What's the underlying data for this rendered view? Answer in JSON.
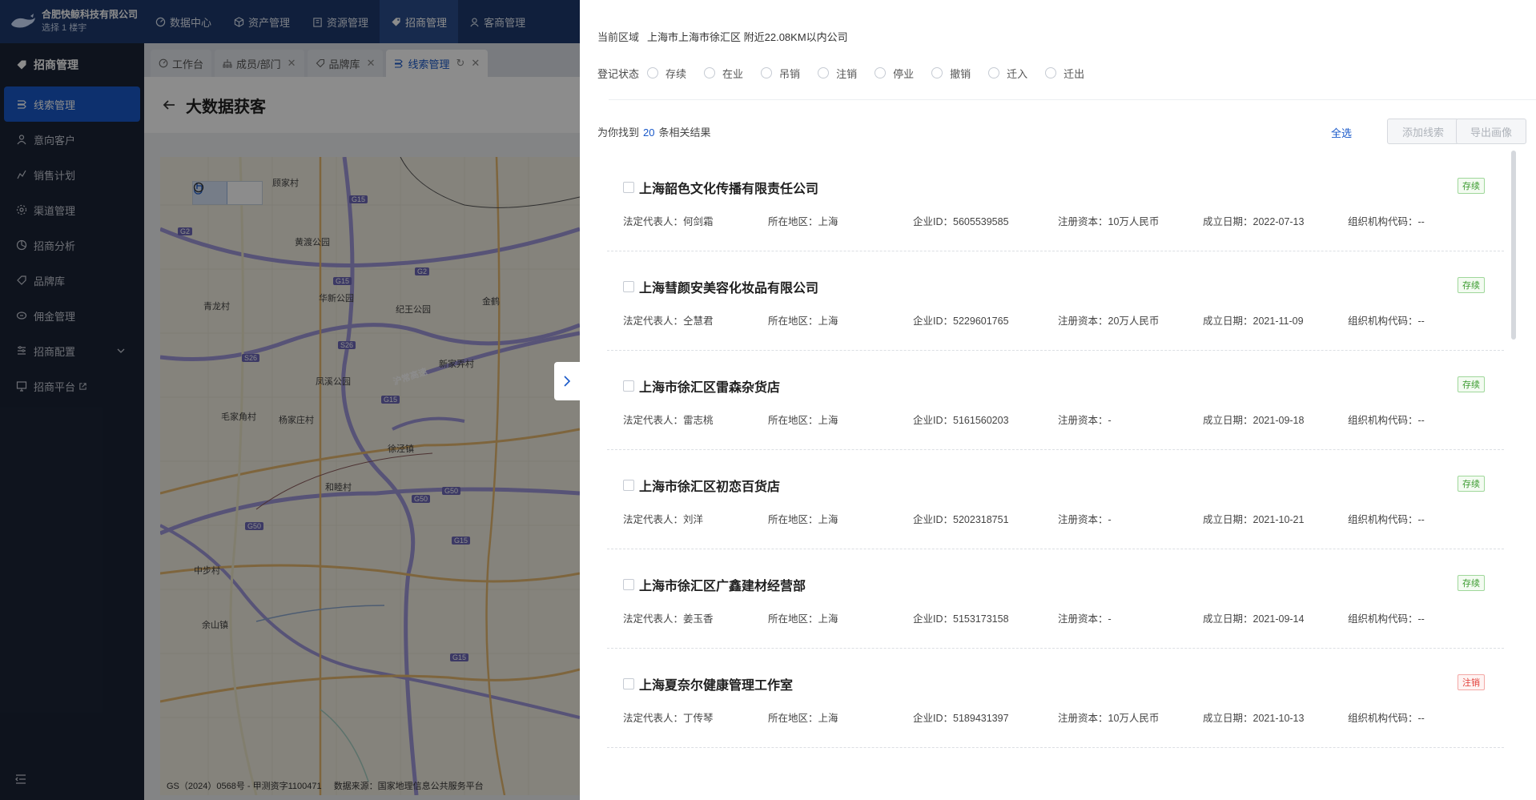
{
  "brand": {
    "name": "合肥快鲸科技有限公司",
    "floor": "选择 1 楼宇"
  },
  "topnav": [
    {
      "label": "数据中心",
      "icon": "dashboard-icon",
      "active": false
    },
    {
      "label": "资产管理",
      "icon": "cube-icon",
      "active": false
    },
    {
      "label": "资源管理",
      "icon": "building-icon",
      "active": false
    },
    {
      "label": "招商管理",
      "icon": "tag-icon",
      "active": true
    },
    {
      "label": "客商管理",
      "icon": "user-group-icon",
      "active": false
    }
  ],
  "sidebar": {
    "title": "招商管理",
    "items": [
      {
        "label": "线索管理",
        "icon": "clue-icon",
        "active": true
      },
      {
        "label": "意向客户",
        "icon": "user-icon"
      },
      {
        "label": "销售计划",
        "icon": "plan-icon"
      },
      {
        "label": "渠道管理",
        "icon": "channel-icon"
      },
      {
        "label": "招商分析",
        "icon": "analysis-icon"
      },
      {
        "label": "品牌库",
        "icon": "brand-icon"
      },
      {
        "label": "佣金管理",
        "icon": "commission-icon"
      },
      {
        "label": "招商配置",
        "icon": "config-icon"
      },
      {
        "label": "招商平台",
        "icon": "platform-icon"
      }
    ]
  },
  "tabs": [
    {
      "label": "工作台",
      "icon": "dashboard-icon"
    },
    {
      "label": "成员/部门",
      "icon": "org-icon"
    },
    {
      "label": "品牌库",
      "icon": "brand-icon"
    },
    {
      "label": "线索管理",
      "icon": "clue-icon"
    }
  ],
  "page": {
    "title": "大数据获客"
  },
  "map": {
    "attribution": "GS（2024）0568号 - 甲测资字1100471",
    "attribution2": "数据来源：国家地理信息公共服务平台",
    "places": [
      "顾家村",
      "黄渡公园",
      "华新公园",
      "青龙村",
      "纪王公园",
      "金鹤",
      "凤溪公园",
      "新家弄村",
      "毛家角村",
      "杨家庄村",
      "徐泾镇",
      "和睦村",
      "中步村",
      "余山镇"
    ],
    "roads": [
      "G15",
      "G2",
      "G15",
      "G2",
      "S26",
      "S26",
      "G15",
      "G50",
      "G50",
      "G50",
      "G15",
      "G15"
    ],
    "road_name": "沪常高速"
  },
  "filters": {
    "region_label": "当前区域",
    "region_value": "上海市上海市徐汇区 附近22.08KM以内公司",
    "status_label": "登记状态",
    "statuses": [
      "存续",
      "在业",
      "吊销",
      "注销",
      "停业",
      "撤销",
      "迁入",
      "迁出"
    ]
  },
  "results": {
    "prefix": "为你找到",
    "count": "20",
    "suffix": "条相关结果",
    "select_all": "全选",
    "add_clue": "添加线索",
    "export": "导出画像"
  },
  "labels": {
    "legal": "法定代表人：",
    "region": "所在地区：",
    "id": "企业ID：",
    "capital": "注册资本：",
    "date": "成立日期：",
    "org": "组织机构代码："
  },
  "companies": [
    {
      "name": "上海韶色文化传播有限责任公司",
      "status": "存续",
      "legal": "何剑霜",
      "region": "上海",
      "id": "5605539585",
      "capital": "10万人民币",
      "date": "2022-07-13",
      "org": "--"
    },
    {
      "name": "上海彗颜安美容化妆品有限公司",
      "status": "存续",
      "legal": "仝慧君",
      "region": "上海",
      "id": "5229601765",
      "capital": "20万人民币",
      "date": "2021-11-09",
      "org": "--"
    },
    {
      "name": "上海市徐汇区雷森杂货店",
      "status": "存续",
      "legal": "雷志桃",
      "region": "上海",
      "id": "5161560203",
      "capital": "-",
      "date": "2021-09-18",
      "org": "--"
    },
    {
      "name": "上海市徐汇区初恋百货店",
      "status": "存续",
      "legal": "刘洋",
      "region": "上海",
      "id": "5202318751",
      "capital": "-",
      "date": "2021-10-21",
      "org": "--"
    },
    {
      "name": "上海市徐汇区广鑫建材经营部",
      "status": "存续",
      "legal": "姜玉香",
      "region": "上海",
      "id": "5153173158",
      "capital": "-",
      "date": "2021-09-14",
      "org": "--"
    },
    {
      "name": "上海夏奈尔健康管理工作室",
      "status": "注销",
      "legal": "丁传琴",
      "region": "上海",
      "id": "5189431397",
      "capital": "10万人民币",
      "date": "2021-10-13",
      "org": "--"
    }
  ]
}
